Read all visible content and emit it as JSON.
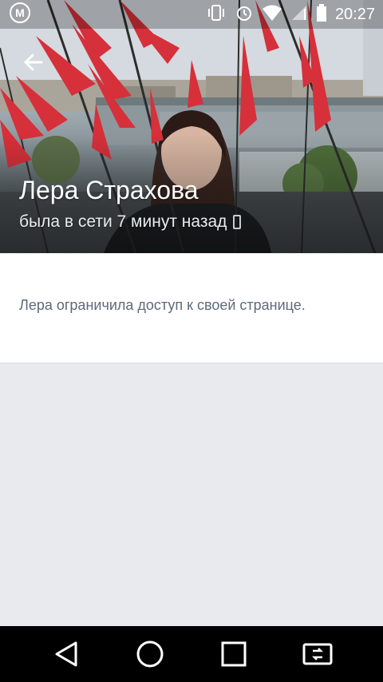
{
  "status_bar": {
    "time": "20:27",
    "icons": [
      "app-m-icon",
      "vibrate-icon",
      "alarm-icon",
      "wifi-icon",
      "signal-icon",
      "battery-icon"
    ]
  },
  "profile": {
    "name": "Лера Страхова",
    "last_seen": "была в сети 7 минут назад"
  },
  "content": {
    "message": "Лера ограничила доступ к своей странице."
  },
  "nav_bar": {
    "buttons": [
      "back-icon",
      "home-icon",
      "recents-icon",
      "screen-switch-icon"
    ]
  },
  "colors": {
    "page_background": "#e8eaed",
    "card_background": "#ffffff",
    "message_text": "#5c6b7a",
    "navbar": "#000000",
    "flag_red": "#d6303a"
  }
}
